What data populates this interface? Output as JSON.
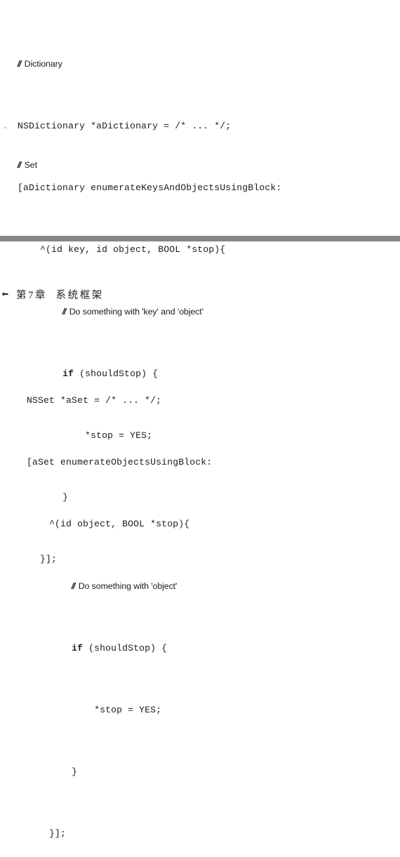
{
  "page": {
    "background": "#ffffff",
    "text_color": "#1c1c1c"
  },
  "code_dictionary": {
    "name": "dictionary-enumeration-sample",
    "language": "Objective-C",
    "lines": [
      {
        "id": "l1",
        "indent": 0,
        "text": "// Dictionary",
        "kind": "comment"
      },
      {
        "id": "l2",
        "indent": 0,
        "text": "NSDictionary *aDictionary = /* ... */;",
        "kind": "code"
      },
      {
        "id": "l3",
        "indent": 0,
        "text": "[aDictionary enumerateKeysAndObjectsUsingBlock:",
        "kind": "code"
      },
      {
        "id": "l4",
        "indent": 4,
        "text": "^(id key, id object, BOOL *stop){",
        "kind": "code"
      },
      {
        "id": "l5",
        "indent": 8,
        "text": "// Do something with 'key' and 'object'",
        "kind": "comment"
      },
      {
        "id": "l6",
        "indent": 8,
        "text": "if (shouldStop) {",
        "kind": "keyword-if"
      },
      {
        "id": "l7",
        "indent": 12,
        "text": "*stop = YES;",
        "kind": "code"
      },
      {
        "id": "l8",
        "indent": 8,
        "text": "}",
        "kind": "code"
      },
      {
        "id": "l9",
        "indent": 4,
        "text": "}];",
        "kind": "code"
      }
    ],
    "keyword": "if",
    "keyword_tail": " (shouldStop) {",
    "comment_slashes": "//",
    "comment_1_text": " Dictionary",
    "comment_2_text": " Do something with 'key' and 'object'"
  },
  "comment_set": {
    "slashes": "//",
    "text": " Set"
  },
  "separator": {
    "color": "#878787"
  },
  "running_header": {
    "bullet_icon": "arrow-bullet-icon",
    "title": "第7章  系统框架"
  },
  "code_set": {
    "name": "set-enumeration-sample",
    "language": "Objective-C",
    "lines": [
      {
        "id": "s1",
        "indent": 0,
        "text": "NSSet *aSet = /* ... */;",
        "kind": "code"
      },
      {
        "id": "s2",
        "indent": 0,
        "text": "[aSet enumerateObjectsUsingBlock:",
        "kind": "code"
      },
      {
        "id": "s3",
        "indent": 4,
        "text": "^(id object, BOOL *stop){",
        "kind": "code"
      },
      {
        "id": "s4",
        "indent": 8,
        "text": "// Do something with 'object'",
        "kind": "comment"
      },
      {
        "id": "s5",
        "indent": 8,
        "text": "if (shouldStop) {",
        "kind": "keyword-if"
      },
      {
        "id": "s6",
        "indent": 12,
        "text": "*stop = YES;",
        "kind": "code"
      },
      {
        "id": "s7",
        "indent": 8,
        "text": "}",
        "kind": "code"
      },
      {
        "id": "s8",
        "indent": 4,
        "text": "}];",
        "kind": "code"
      }
    ],
    "keyword": "if",
    "keyword_tail": " (shouldStop) {",
    "comment_slashes": "//",
    "comment_text": " Do something with 'object'"
  }
}
